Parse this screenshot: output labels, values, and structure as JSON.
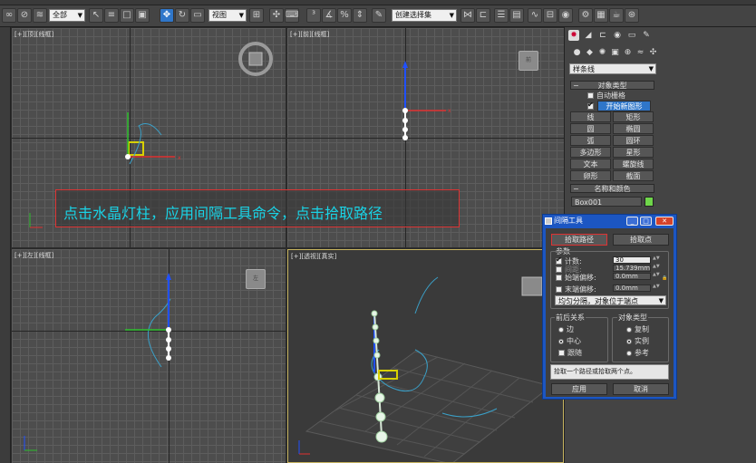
{
  "toolbar": {
    "selection_filter": "全部",
    "view_dropdown": "视图",
    "named_selection_sets": "创建选择集"
  },
  "viewports": {
    "top": {
      "label": "[+][顶][线框]",
      "cube": "上"
    },
    "front": {
      "label": "[+][前][线框]",
      "cube": "前"
    },
    "left": {
      "label": "[+][左][线框]",
      "cube": "左"
    },
    "perspective": {
      "label": "[+][透视][真实]",
      "cube": ""
    }
  },
  "caption": "点击水晶灯柱，应用间隔工具命令，点击拾取路径",
  "command_panel": {
    "category_dropdown": "样条线",
    "object_type_title": "对象类型",
    "autogrid_label": "自动栅格",
    "start_new_shape": "开始新图形",
    "object_buttons": [
      "线",
      "矩形",
      "圆",
      "椭圆",
      "弧",
      "圆环",
      "多边形",
      "星形",
      "文本",
      "螺旋线",
      "卵形",
      "截面"
    ],
    "name_color_title": "名称和颜色",
    "object_name": "Box001",
    "object_color": "#6fd64a"
  },
  "dialog": {
    "title": "间隔工具",
    "pick_path": "拾取路径",
    "pick_points": "拾取点",
    "params_title": "参数",
    "count_label": "计数:",
    "count_value": "30",
    "spacing_label": "间距:",
    "spacing_value": "15.739mm",
    "start_offset_label": "始端偏移:",
    "start_offset_value": "0.0mm",
    "end_offset_label": "末端偏移:",
    "end_offset_value": "0.0mm",
    "distribution": "均匀分隔，对象位于端点",
    "context_title": "前后关系",
    "context_options": [
      "边",
      "中心",
      "跟随"
    ],
    "type_title": "对象类型",
    "type_options": [
      "复制",
      "实例",
      "参考"
    ],
    "status_text": "拾取一个路径或拾取两个点。",
    "apply": "应用",
    "cancel": "取消"
  }
}
